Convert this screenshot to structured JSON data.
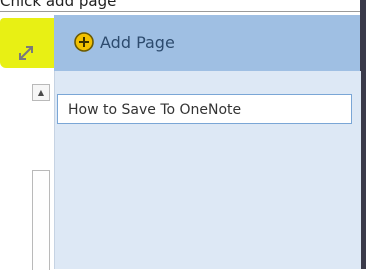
{
  "caption": "Cnick add page",
  "toolbar": {
    "add_page_label": "Add Page",
    "add_icon": "plus-circle-icon",
    "expand_icon": "expand-arrows-icon"
  },
  "scrollbar": {
    "up_arrow": "▲"
  },
  "pages": {
    "items": [
      {
        "title": "How to Save To OneNote"
      }
    ]
  },
  "colors": {
    "highlight": "#e6ef00",
    "header_band": "#9fbfe3",
    "panel": "#dde8f5",
    "selection_border": "#7aa6d6",
    "icon_fill": "#f2c100"
  }
}
